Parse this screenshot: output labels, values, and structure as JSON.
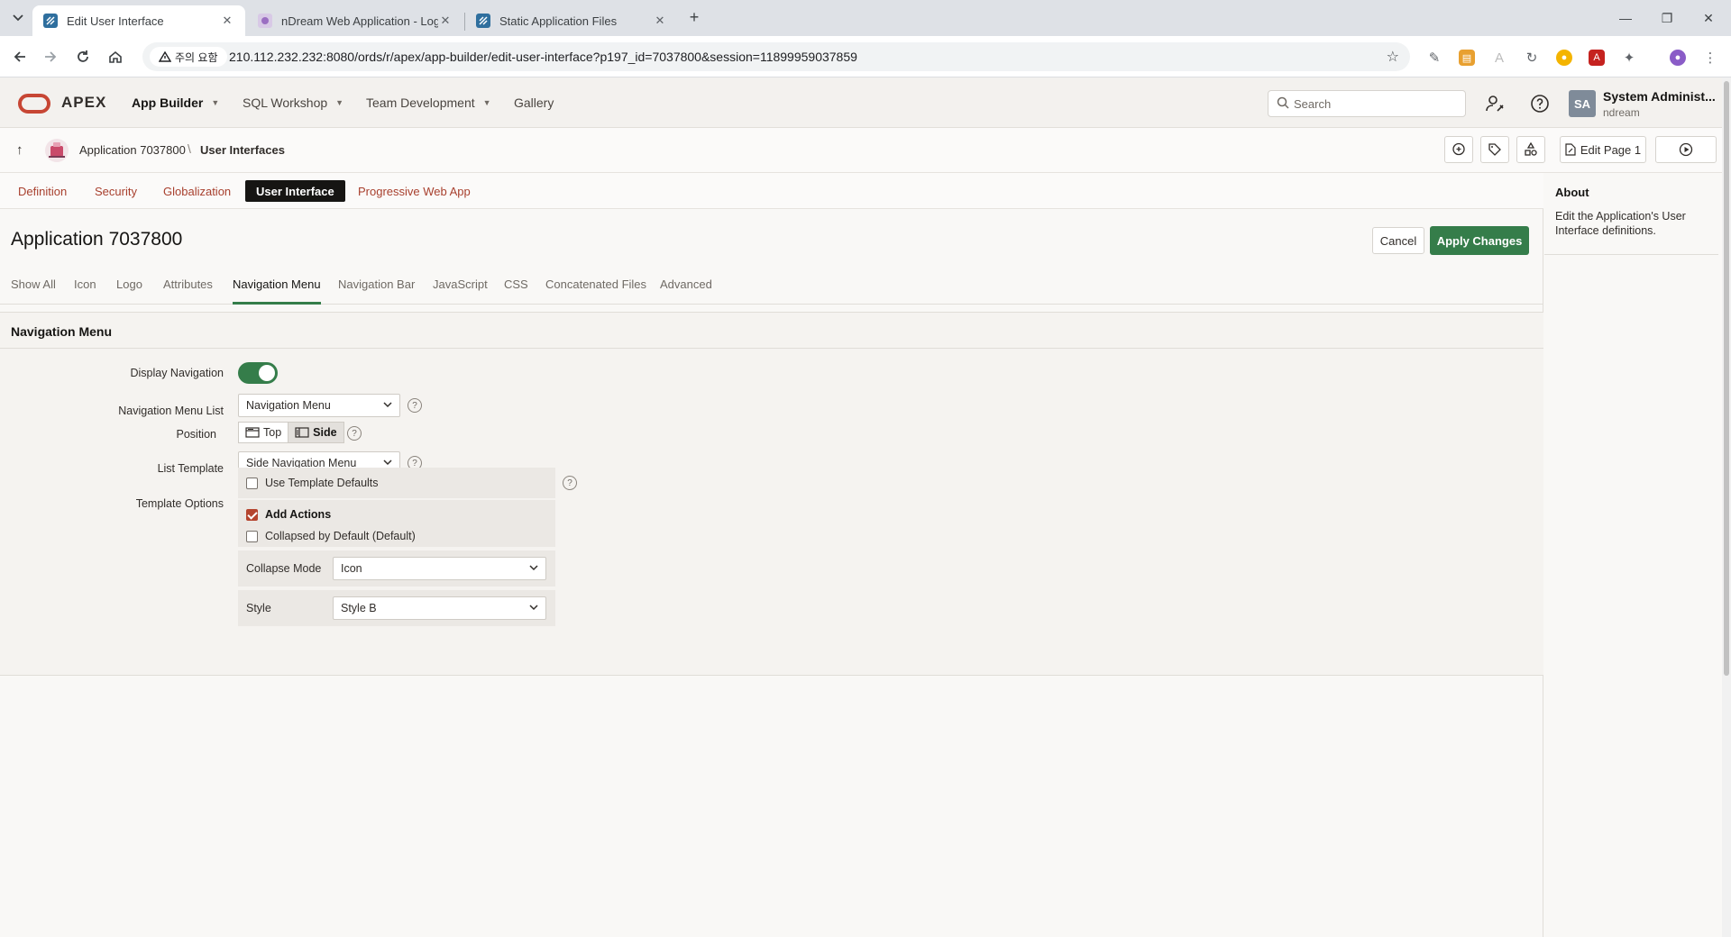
{
  "browser": {
    "tabs": [
      {
        "title": "Edit User Interface",
        "active": true
      },
      {
        "title": "nDream Web Application - Log",
        "active": false
      },
      {
        "title": "Static Application Files",
        "active": false
      }
    ],
    "address": {
      "warning": "주의 요함",
      "url": "210.112.232.232:8080/ords/r/apex/app-builder/edit-user-interface?p197_id=7037800&session=11899959037859"
    }
  },
  "header": {
    "brand": "APEX",
    "nav": [
      {
        "label": "App Builder",
        "active": true
      },
      {
        "label": "SQL Workshop",
        "active": false
      },
      {
        "label": "Team Development",
        "active": false
      },
      {
        "label": "Gallery",
        "active": false
      }
    ],
    "search_placeholder": "Search",
    "user": {
      "initials": "SA",
      "name": "System Administ...",
      "workspace": "ndream"
    }
  },
  "breadcrumb": {
    "items": [
      "Application 7037800",
      "User Interfaces"
    ],
    "edit_page_label": "Edit Page 1"
  },
  "subtabs": [
    {
      "label": "Definition",
      "active": false
    },
    {
      "label": "Security",
      "active": false
    },
    {
      "label": "Globalization",
      "active": false
    },
    {
      "label": "User Interface",
      "active": true
    },
    {
      "label": "Progressive Web App",
      "active": false
    }
  ],
  "page": {
    "title": "Application 7037800",
    "cancel_label": "Cancel",
    "apply_label": "Apply Changes"
  },
  "section_tabs": [
    {
      "label": "Show All",
      "active": false
    },
    {
      "label": "Icon",
      "active": false
    },
    {
      "label": "Logo",
      "active": false
    },
    {
      "label": "Attributes",
      "active": false
    },
    {
      "label": "Navigation Menu",
      "active": true
    },
    {
      "label": "Navigation Bar",
      "active": false
    },
    {
      "label": "JavaScript",
      "active": false
    },
    {
      "label": "CSS",
      "active": false
    },
    {
      "label": "Concatenated Files",
      "active": false
    },
    {
      "label": "Advanced",
      "active": false
    }
  ],
  "region": {
    "title": "Navigation Menu",
    "display_navigation": {
      "label": "Display Navigation",
      "on": true
    },
    "menu_list": {
      "label": "Navigation Menu List",
      "value": "Navigation Menu"
    },
    "position": {
      "label": "Position",
      "options": [
        "Top",
        "Side"
      ],
      "selected": "Side"
    },
    "list_template": {
      "label": "List Template",
      "value": "Side Navigation Menu"
    },
    "template_options": {
      "label": "Template Options",
      "use_defaults": {
        "label": "Use Template Defaults",
        "checked": false
      },
      "add_actions": {
        "label": "Add Actions",
        "checked": true
      },
      "collapsed_default": {
        "label": "Collapsed by Default (Default)",
        "checked": false
      },
      "collapse_mode": {
        "label": "Collapse Mode",
        "value": "Icon"
      },
      "style": {
        "label": "Style",
        "value": "Style B"
      }
    },
    "help_glyph": "?"
  },
  "about": {
    "title": "About",
    "text": "Edit the Application's User Interface definitions."
  },
  "colors": {
    "accent": "#357d4a",
    "link": "#a8402e",
    "oracle_red": "#c74634"
  }
}
